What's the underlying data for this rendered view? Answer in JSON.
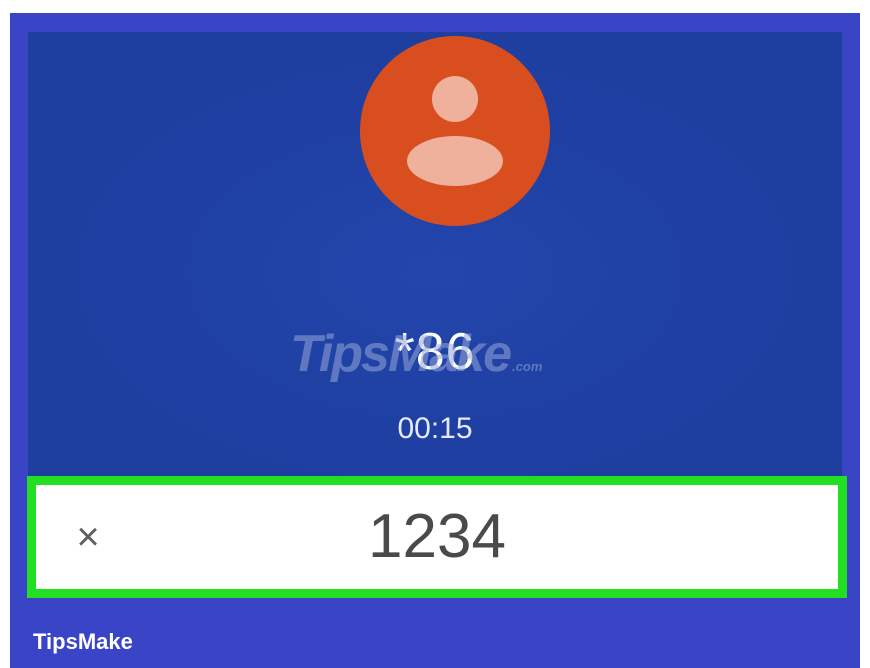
{
  "call": {
    "caller_number": "*86",
    "duration": "00:15"
  },
  "dialpad": {
    "clear_icon": "×",
    "input_value": "1234"
  },
  "watermark": {
    "text": "TipsMake",
    "suffix": ".com"
  },
  "brand": {
    "label": "TipsMake"
  },
  "colors": {
    "frame": "#3a44c6",
    "screen": "#1e3ea0",
    "avatar": "#d84e1f",
    "highlight": "#22e021"
  }
}
